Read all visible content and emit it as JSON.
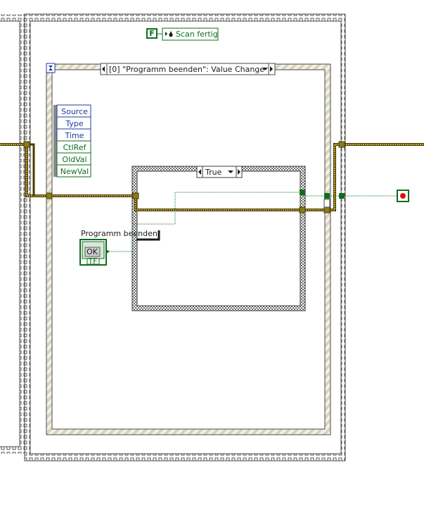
{
  "colors": {
    "frame_light": "#ffffff",
    "frame_dark": "#4a4a4a",
    "event_struct_stripe": "#d8d4c0",
    "case_struct_stripe": "#6a6a6a",
    "cluster_wire": "#8a7a1a",
    "cluster_wire_edge": "#4a3a00",
    "bool_wire": "#1a7a2a",
    "node_blue": "#1e3aa0",
    "node_green": "#0f6e1e",
    "stop_red": "#e01010"
  },
  "local_variable": {
    "tf": "F",
    "name": "Scan fertig"
  },
  "event_structure": {
    "selector": "[0] \"Programm beenden\": Value Change",
    "timeout_icon": "hourglass-icon",
    "event_data_node": [
      "Source",
      "Type",
      "Time",
      "CtlRef",
      "OldVal",
      "NewVal"
    ]
  },
  "case_structure": {
    "selector": "True"
  },
  "terminal": {
    "label": "Programm beenden",
    "button_text": "OK",
    "tf": "TF"
  },
  "stop_terminal": {
    "icon": "stop-icon"
  }
}
